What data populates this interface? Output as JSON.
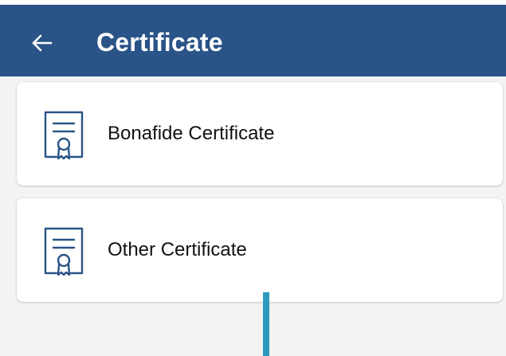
{
  "app_bar": {
    "title": "Certificate",
    "back_icon": "arrow-left-icon",
    "background_color": "#2a5387"
  },
  "certificates": [
    {
      "label": "Bonafide Certificate",
      "icon": "certificate-icon"
    },
    {
      "label": "Other Certificate",
      "icon": "certificate-icon"
    }
  ],
  "colors": {
    "background": "#f3f3f3",
    "card": "#ffffff",
    "icon_stroke": "#2a5387",
    "indicator": "#2e9ac0"
  }
}
